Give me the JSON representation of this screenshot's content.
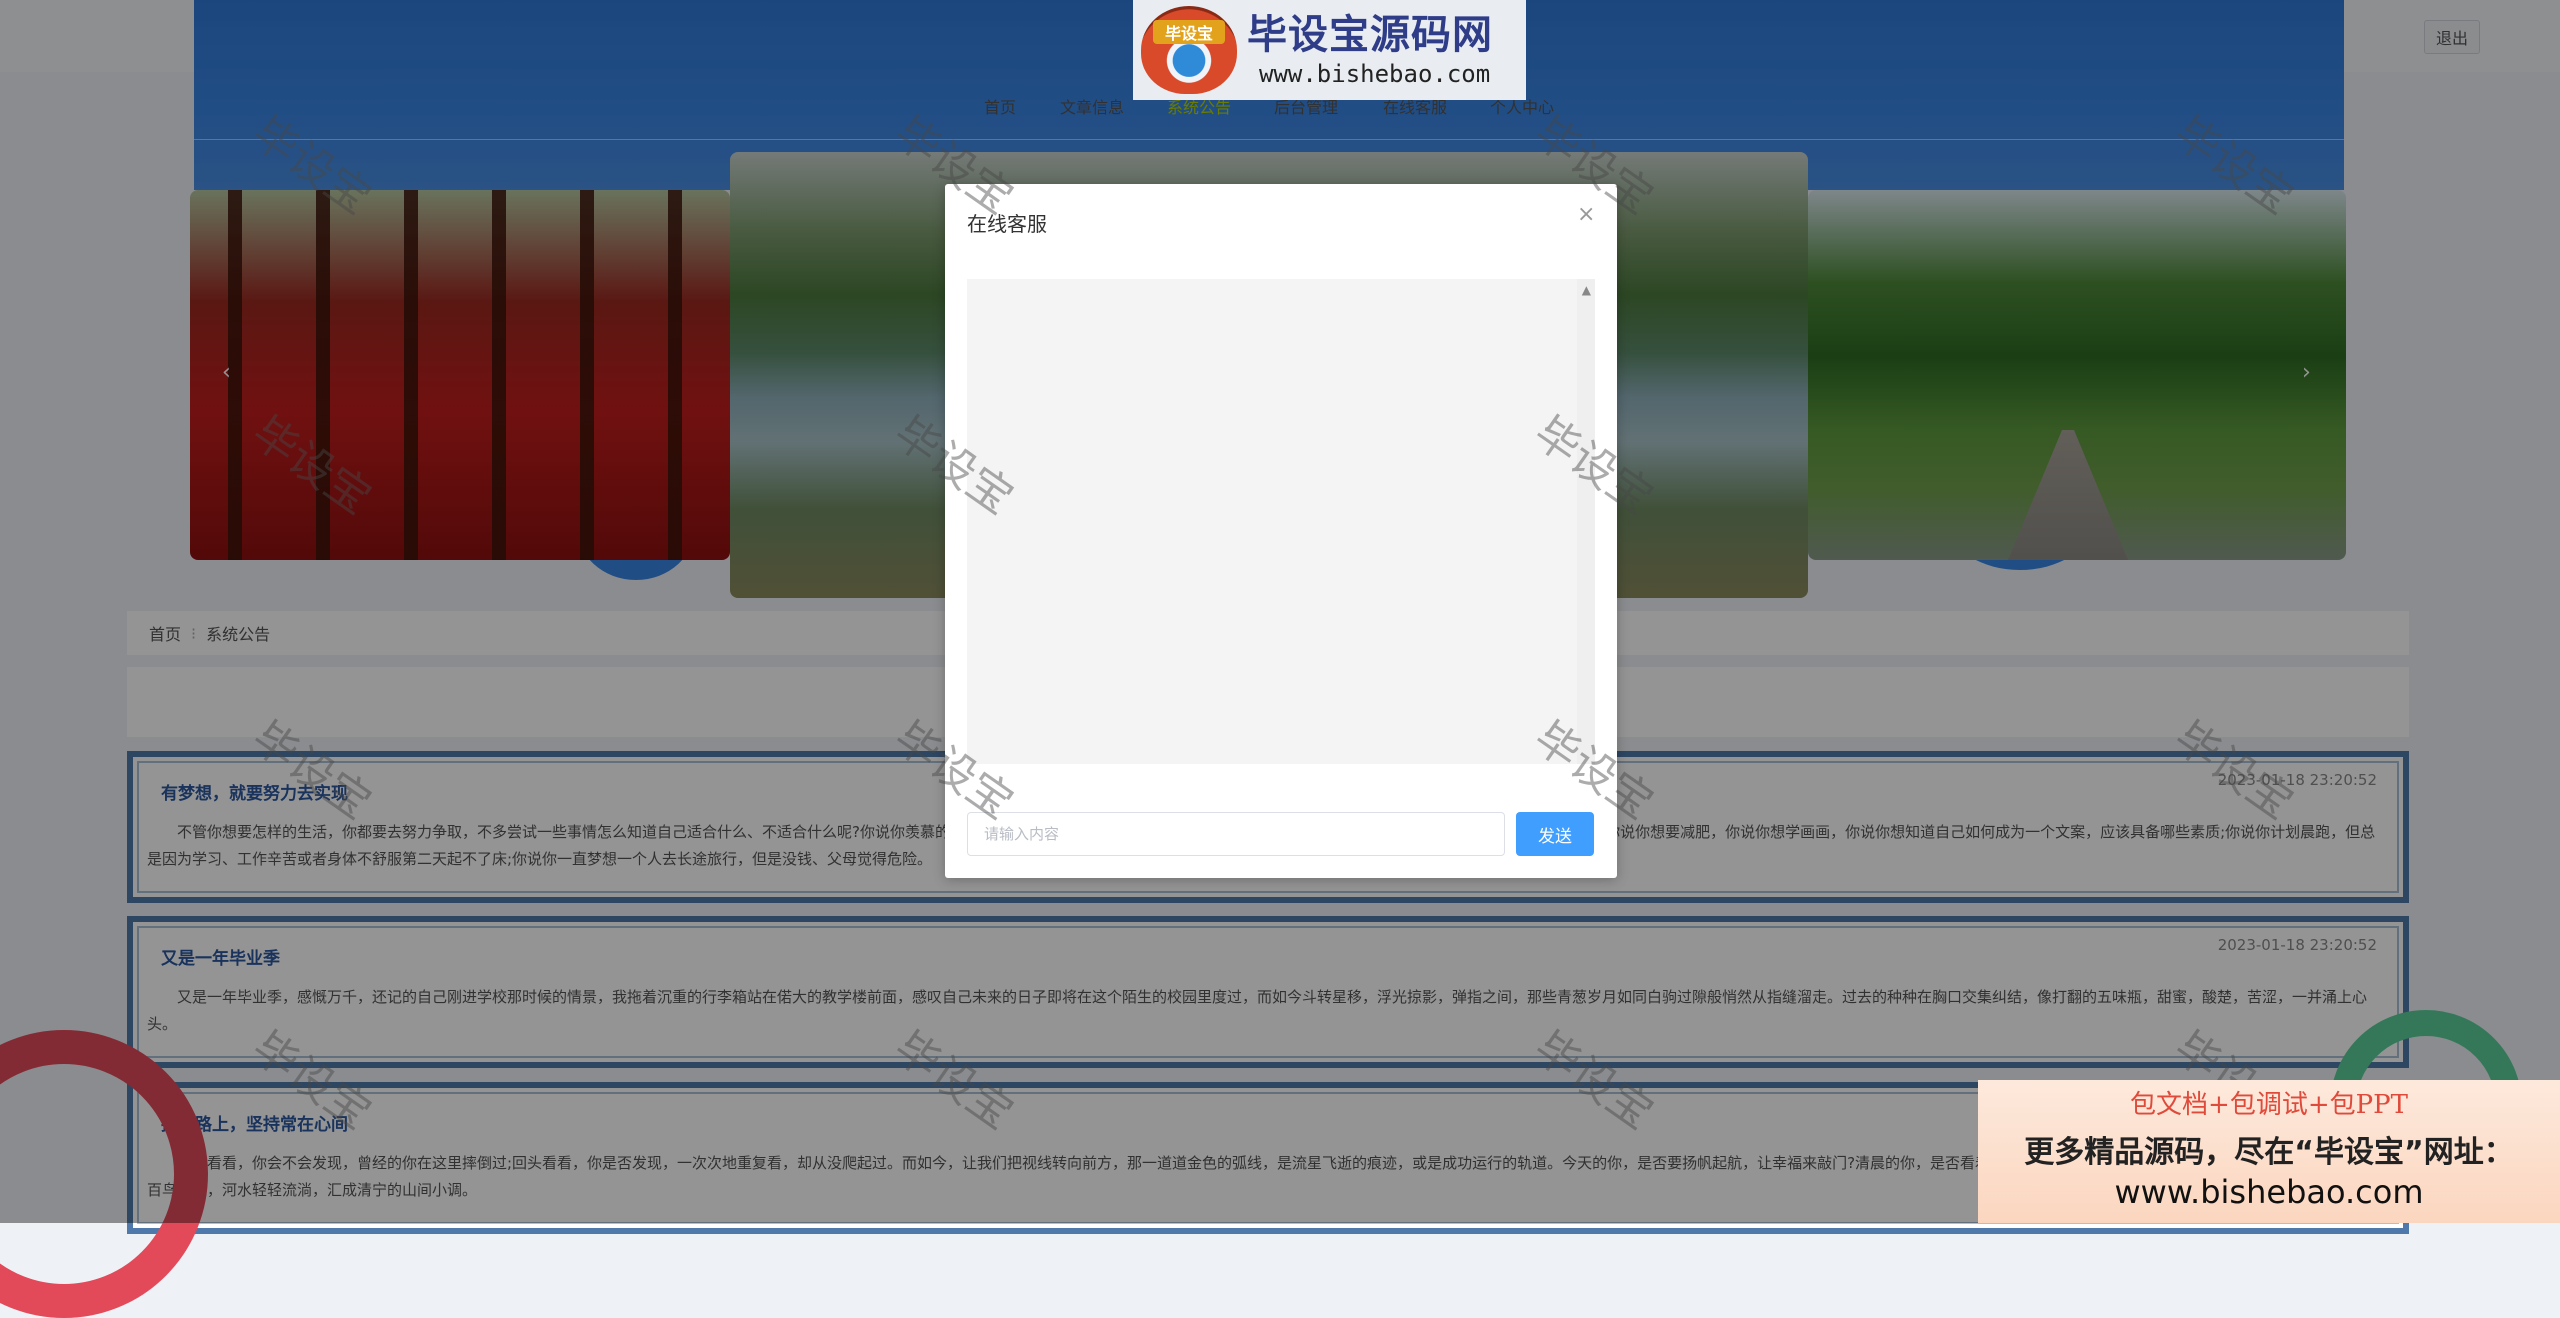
{
  "header": {
    "logout_label": "退出",
    "brand": {
      "emblem_text": "毕设宝",
      "name": "毕设宝源码网",
      "url": "www.bishebao.com"
    },
    "nav": [
      {
        "label": "首页"
      },
      {
        "label": "文章信息"
      },
      {
        "label": "系统公告"
      },
      {
        "label": "后台管理"
      },
      {
        "label": "在线客服"
      },
      {
        "label": "个人中心"
      }
    ]
  },
  "carousel": {
    "prev_icon": "‹",
    "next_icon": "›"
  },
  "breadcrumb": {
    "home": "首页",
    "separator": "⁝",
    "current": "系统公告"
  },
  "notices": [
    {
      "title": "有梦想，就要努力去实现",
      "date": "2023-01-18 23:20:52",
      "body": "不管你想要怎样的生活，你都要去努力争取，不多尝试一些事情怎么知道自己适合什么、不适合什么呢?你说你羡慕的那些人，只是羡慕而已;你说你也想要去旅行去看世界，你说你想成为一个文案，应该具备哪些素质;你说你想要减肥，你说你想学画画，你说你想知道自己如何成为一个文案，应该具备哪些素质;你说你计划晨跑，但总是因为学习、工作辛苦或者身体不舒服第二天起不了床;你说你一直梦想一个人去长途旅行，但是没钱、父母觉得危险。"
    },
    {
      "title": "又是一年毕业季",
      "date": "2023-01-18 23:20:52",
      "body": "又是一年毕业季，感慨万千，还记的自己刚进学校那时候的情景，我拖着沉重的行李箱站在偌大的教学楼前面，感叹自己未来的日子即将在这个陌生的校园里度过，而如今斗转星移，浮光掠影，弹指之间，那些青葱岁月如同白驹过隙般悄然从指缝溜走。过去的种种在胸口交集纠结，像打翻的五味瓶，甜蜜，酸楚，苦涩，一并涌上心头。"
    },
    {
      "title": "挫折路上，坚持常在心间",
      "date": "",
      "body": "回头看看，你会不会发现，曾经的你在这里摔倒过;回头看看，你是否发现，一次次地重复看，却从没爬起过。而如今，让我们把视线转向前方，那一道道金色的弧线，是流星飞逝的痕迹，或是成功运行的轨道。今天的你，是否要扬帆起航，让幸福来敲门?清晨的你，是否看着枝头绽放的花朵，看春光，世界因太阳的照射而精彩，林中百鸟啾啾，河水轻轻流淌，汇成清宁的山间小调。"
    }
  ],
  "modal": {
    "title": "在线客服",
    "close_icon": "×",
    "input_placeholder": "请输入内容",
    "send_label": "发送"
  },
  "watermark": "毕设宝",
  "promo": {
    "line1": "包文档+包调试+包PPT",
    "line2": "更多精品源码，尽在“毕设宝”网址：",
    "line3": "www.bishebao.com"
  },
  "colors": {
    "primary": "#409eff",
    "hero_blue": "#3a86e6",
    "notice_border": "#4f79aa"
  }
}
